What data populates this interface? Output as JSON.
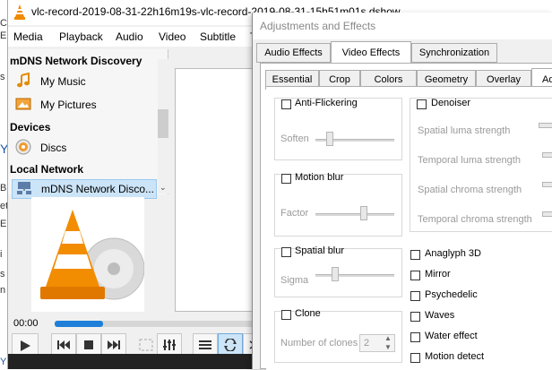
{
  "background_page": {
    "chars": [
      "C",
      "E",
      "s",
      "Y",
      "B",
      "et",
      "E",
      "i",
      "s",
      "n",
      "Y"
    ]
  },
  "vlc": {
    "title": "vlc-record-2019-08-31-22h16m19s-vlc-record-2019-08-31-15h51m01s.dshow",
    "menu": [
      "Media",
      "Playback",
      "Audio",
      "Video",
      "Subtitle",
      "T"
    ],
    "sidebar": {
      "header_top": "mDNS Network Discovery",
      "items": [
        {
          "label": "My Music",
          "icon": "music-note-icon"
        },
        {
          "label": "My Pictures",
          "icon": "picture-icon"
        }
      ],
      "section_devices": "Devices",
      "discs": "Discs",
      "section_local": "Local Network",
      "mdns": "mDNS Network Disco..."
    },
    "time": "00:00",
    "progress": 0.22,
    "accent": "#1e7fd8"
  },
  "dialog": {
    "title": "Adjustments and Effects",
    "top_tabs": [
      "Audio Effects",
      "Video Effects",
      "Synchronization"
    ],
    "active_top_tab": "Video Effects",
    "sub_tabs": [
      "Essential",
      "Crop",
      "Colors",
      "Geometry",
      "Overlay",
      "Ad"
    ],
    "active_sub_tab": "Ad",
    "anti_flicker": {
      "label": "Anti-Flickering",
      "param": "Soften",
      "level": 0.15
    },
    "motion_blur": {
      "label": "Motion blur",
      "param": "Factor",
      "level": 0.62
    },
    "spatial_blur": {
      "label": "Spatial blur",
      "param": "Sigma",
      "level": 0.22
    },
    "clone": {
      "label": "Clone",
      "param": "Number of clones",
      "value": "2"
    },
    "denoiser": {
      "label": "Denoiser",
      "params": [
        "Spatial luma strength",
        "Temporal luma strength",
        "Spatial chroma strength",
        "Temporal chroma strength"
      ]
    },
    "checks": [
      "Anaglyph 3D",
      "Mirror",
      "Psychedelic",
      "Waves",
      "Water effect",
      "Motion detect"
    ]
  }
}
